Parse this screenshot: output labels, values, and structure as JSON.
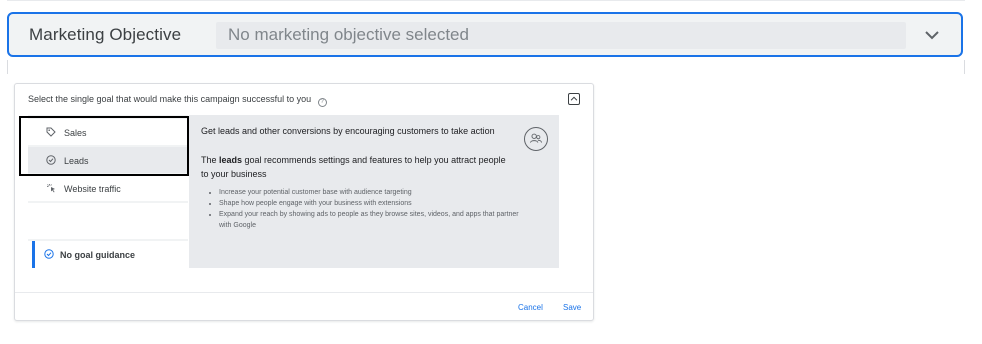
{
  "objective": {
    "title": "Marketing Objective",
    "value": "No marketing objective selected",
    "chevron": "chevron-down-icon"
  },
  "goal_panel": {
    "prompt": "Select the single goal that would make this campaign successful to you",
    "help_icon": "help-icon",
    "collapse_icon": "chevron-up-icon",
    "goals": [
      {
        "label": "Sales",
        "icon": "tag-icon"
      },
      {
        "label": "Leads",
        "icon": "check-circle-icon"
      },
      {
        "label": "Website traffic",
        "icon": "cursor-click-icon"
      }
    ],
    "no_goal": {
      "label": "No goal guidance",
      "icon": "check-circle-icon"
    },
    "detail": {
      "headline": "Get leads and other conversions by encouraging customers to take action",
      "description_pre": "The ",
      "description_bold": "leads",
      "description_post": " goal recommends settings and features to help you attract people to your business",
      "bullets": [
        "Increase your potential customer base with audience targeting",
        "Shape how people engage with your business with extensions",
        "Expand your reach by showing ads to people as they browse sites, videos, and apps that partner with Google"
      ],
      "badge_icon": "people-icon"
    },
    "cancel_label": "Cancel",
    "save_label": "Save"
  },
  "colors": {
    "accent": "#1a73e8",
    "bar_bg": "#f1f3f4",
    "detail_bg": "#e8eaed"
  }
}
